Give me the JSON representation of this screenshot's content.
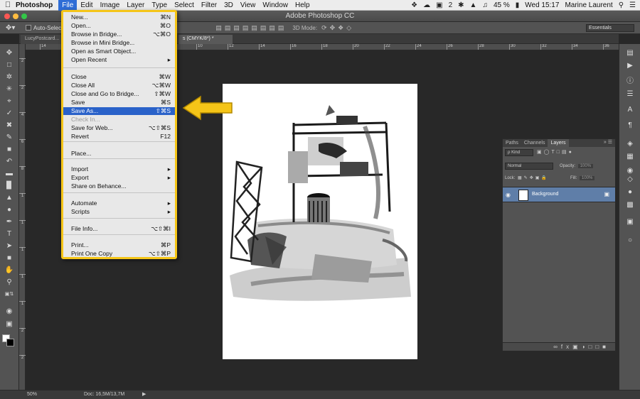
{
  "menubar": {
    "apple": "",
    "app_name": "Photoshop",
    "items": [
      "File",
      "Edit",
      "Image",
      "Layer",
      "Type",
      "Select",
      "Filter",
      "3D",
      "View",
      "Window",
      "Help"
    ],
    "active_item": "File",
    "status": {
      "battery": "45 %",
      "clock": "Wed 15:17",
      "user": "Marine Laurent",
      "notif_count": "2"
    }
  },
  "window": {
    "title": "Adobe Photoshop CC"
  },
  "options": {
    "auto_select": "Auto-Select",
    "mode_3d": "3D Mode:",
    "workspace": "Essentials"
  },
  "tabs": [
    {
      "label": "LucyPostcard..."
    },
    {
      "label": "s (CMYK/8*) *"
    }
  ],
  "rulers": {
    "h": [
      "14",
      "2",
      "4",
      "6",
      "8",
      "10",
      "12",
      "14",
      "16",
      "18",
      "20",
      "22",
      "24",
      "26",
      "28",
      "30",
      "32",
      "34",
      "36",
      "38"
    ],
    "v": [
      "2",
      "2",
      "4",
      "6",
      "8",
      "1",
      "1",
      "1",
      "1",
      "1",
      "2",
      "2"
    ]
  },
  "file_menu": {
    "items": [
      {
        "label": "New...",
        "shortcut": "⌘N"
      },
      {
        "label": "Open...",
        "shortcut": "⌘O"
      },
      {
        "label": "Browse in Bridge...",
        "shortcut": "⌥⌘O"
      },
      {
        "label": "Browse in Mini Bridge...",
        "shortcut": ""
      },
      {
        "label": "Open as Smart Object...",
        "shortcut": ""
      },
      {
        "label": "Open Recent",
        "shortcut": "▸"
      },
      {
        "label": "Close",
        "shortcut": "⌘W"
      },
      {
        "label": "Close All",
        "shortcut": "⌥⌘W"
      },
      {
        "label": "Close and Go to Bridge...",
        "shortcut": "⇧⌘W"
      },
      {
        "label": "Save",
        "shortcut": "⌘S"
      },
      {
        "label": "Save As...",
        "shortcut": "⇧⌘S",
        "highlighted": true
      },
      {
        "label": "Check In...",
        "shortcut": "",
        "disabled": true
      },
      {
        "label": "Save for Web...",
        "shortcut": "⌥⇧⌘S"
      },
      {
        "label": "Revert",
        "shortcut": "F12"
      },
      {
        "label": "Place...",
        "shortcut": ""
      },
      {
        "label": "Import",
        "shortcut": "▸"
      },
      {
        "label": "Export",
        "shortcut": "▸"
      },
      {
        "label": "Share on Behance...",
        "shortcut": ""
      },
      {
        "label": "Automate",
        "shortcut": "▸"
      },
      {
        "label": "Scripts",
        "shortcut": "▸"
      },
      {
        "label": "File Info...",
        "shortcut": "⌥⇧⌘I"
      },
      {
        "label": "Print...",
        "shortcut": "⌘P"
      },
      {
        "label": "Print One Copy",
        "shortcut": "⌥⇧⌘P"
      }
    ]
  },
  "layers_panel": {
    "tabs": [
      "Paths",
      "Channels",
      "Layers"
    ],
    "active_tab": "Layers",
    "filter_kind": "ρ Kind",
    "blend_mode": "Normal",
    "opacity_label": "Opacity:",
    "opacity_value": "100%",
    "lock_label": "Lock:",
    "fill_label": "Fill:",
    "fill_value": "100%",
    "layers": [
      {
        "name": "Background",
        "visible": true,
        "locked": true
      }
    ]
  },
  "status": {
    "zoom": "50%",
    "doc": "Doc: 16,5M/13,7M"
  },
  "colors": {
    "highlight": "#2a62c9",
    "callout": "#f5c518",
    "ui_dark": "#282828",
    "panel": "#535353"
  }
}
